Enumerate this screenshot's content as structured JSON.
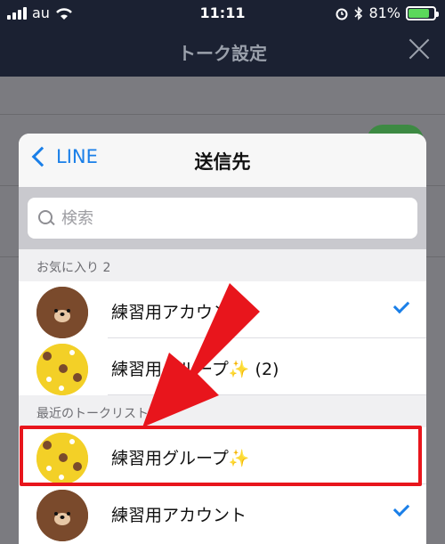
{
  "status_bar": {
    "carrier": "au",
    "time": "11:11",
    "battery": "81%",
    "battery_level": 0.81
  },
  "background": {
    "title": "トーク設定"
  },
  "sheet": {
    "back_label": "LINE",
    "title": "送信先",
    "search_placeholder": "検索",
    "favorites_header": "お気に入り 2",
    "favorites": [
      {
        "label": "練習用アカウント",
        "avatar": "brown-bear",
        "checked": true
      },
      {
        "label": "練習用グループ✨ (2)",
        "avatar": "yellow-pattern",
        "checked": false
      }
    ],
    "recent_header": "最近のトークリスト",
    "recent": [
      {
        "label": "練習用グループ✨",
        "avatar": "yellow-pattern",
        "checked": false,
        "highlighted": true
      },
      {
        "label": "練習用アカウント",
        "avatar": "brown-bear",
        "checked": true
      }
    ]
  },
  "colors": {
    "accent": "#1a7fe8",
    "highlight": "#e8151c",
    "toggle_on": "#4cd964"
  }
}
